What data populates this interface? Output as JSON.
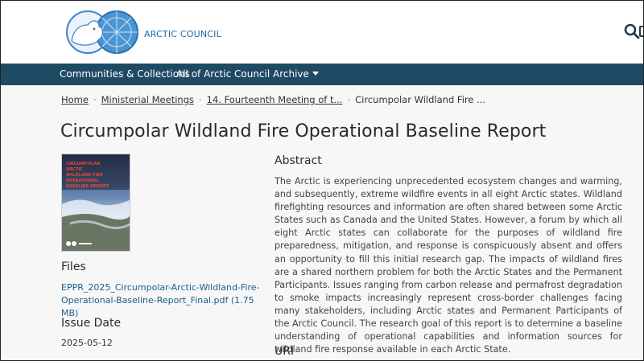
{
  "header": {
    "brand_name": "ARCTIC COUNCIL",
    "search_icon": "search-icon"
  },
  "nav": {
    "communities": "Communities & Collections",
    "archive": "All of Arctic Council Archive"
  },
  "breadcrumb": {
    "home": "Home",
    "ministerial": "Ministerial Meetings",
    "meeting": "14. Fourteenth Meeting of t...",
    "current": "Circumpolar Wildland Fire ..."
  },
  "page": {
    "title": "Circumpolar Wildland Fire Operational Baseline Report"
  },
  "cover": {
    "title_lines": [
      "CIRCUMPOLAR",
      "ARCTIC",
      "WILDLAND FIRE",
      "OPERATIONAL",
      "BASELINE REPORT"
    ]
  },
  "files": {
    "heading": "Files",
    "file_name": "EPPR_2025_Circumpolar-Arctic-Wildland-Fire-Operational-Baseline-Report_Final.pdf (1.75 MB)"
  },
  "issue": {
    "heading": "Issue Date",
    "date": "2025-05-12"
  },
  "abstract": {
    "heading": "Abstract",
    "text": "The Arctic is experiencing unprecedented ecosystem changes and warming, and subsequently, extreme wildfire events in all eight Arctic states. Wildland firefighting resources and information are often shared between some Arctic States such as Canada and the United States. However, a forum by which all eight Arctic states can collaborate for the purposes of wildland fire preparedness, mitigation, and response is conspicuously absent and offers an opportunity to fill this initial research gap. The impacts of wildland fires are a shared northern problem for both the Arctic States and the Permanent Participants. Issues ranging from carbon release and permafrost degradation to smoke impacts increasingly represent cross-border challenges facing many stakeholders, including Arctic states and Permanent Participants of the Arctic Council. The research goal of this report is to determine a baseline understanding of operational capabilities and information sources for wildland fire response available in each Arctic State."
  },
  "uri": {
    "heading": "URI"
  },
  "colors": {
    "navbar": "#1e4a63",
    "link": "#1a5e8f",
    "brand": "#1a6aa8"
  }
}
